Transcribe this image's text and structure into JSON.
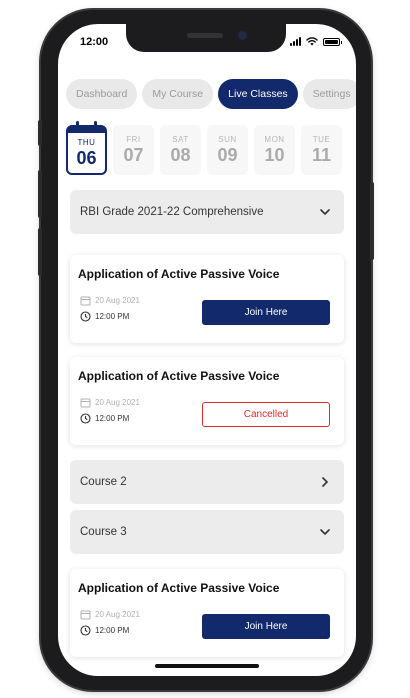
{
  "status_bar": {
    "time": "12:00"
  },
  "tabs": [
    {
      "label": "Dashboard",
      "active": false
    },
    {
      "label": "My Course",
      "active": false
    },
    {
      "label": "Live Classes",
      "active": true
    },
    {
      "label": "Settings",
      "active": false
    }
  ],
  "dates": [
    {
      "day": "THU",
      "num": "06",
      "selected": true
    },
    {
      "day": "FRI",
      "num": "07",
      "selected": false
    },
    {
      "day": "SAT",
      "num": "08",
      "selected": false
    },
    {
      "day": "SUN",
      "num": "09",
      "selected": false
    },
    {
      "day": "MON",
      "num": "10",
      "selected": false
    },
    {
      "day": "TUE",
      "num": "11",
      "selected": false
    }
  ],
  "courses": [
    {
      "label": "RBI Grade 2021-22 Comprehensive",
      "chevron": "chevron-down-icon"
    },
    {
      "label": "Course 2",
      "chevron": "chevron-right-icon"
    },
    {
      "label": "Course 3",
      "chevron": "chevron-down-icon"
    }
  ],
  "classes": [
    {
      "title": "Application of Active Passive Voice",
      "date": "20 Aug 2021",
      "time": "12:00 PM",
      "action": "Join Here",
      "status": "join"
    },
    {
      "title": "Application of Active Passive Voice",
      "date": "20 Aug 2021",
      "time": "12:00 PM",
      "action": "Cancelled",
      "status": "cancelled"
    },
    {
      "title": "Application of Active Passive Voice",
      "date": "20 Aug 2021",
      "time": "12:00 PM",
      "action": "Join Here",
      "status": "join"
    }
  ],
  "colors": {
    "primary": "#12296b",
    "cancelled": "#e02b2b",
    "chip_bg": "#e9e9e9"
  }
}
